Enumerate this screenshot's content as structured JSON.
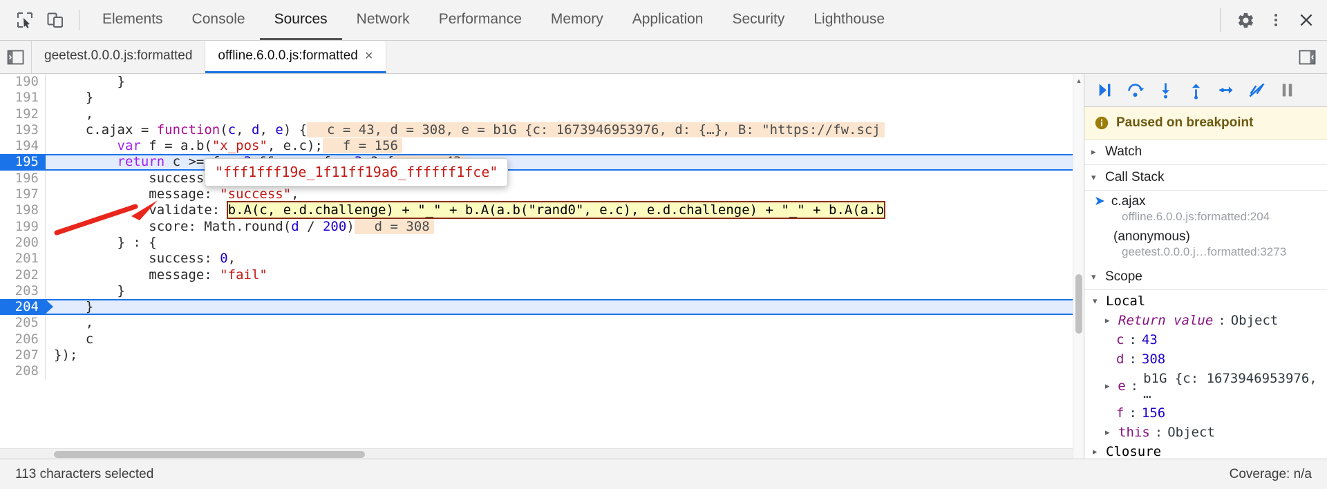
{
  "toolbar": {
    "inspect_icon": "inspect-element-icon",
    "device_icon": "device-toolbar-icon",
    "settings_icon": "gear-icon",
    "more_icon": "more-vertical-icon",
    "close_icon": "close-icon",
    "tabs": [
      {
        "label": "Elements",
        "selected": false
      },
      {
        "label": "Console",
        "selected": false
      },
      {
        "label": "Sources",
        "selected": true
      },
      {
        "label": "Network",
        "selected": false
      },
      {
        "label": "Performance",
        "selected": false
      },
      {
        "label": "Memory",
        "selected": false
      },
      {
        "label": "Application",
        "selected": false
      },
      {
        "label": "Security",
        "selected": false
      },
      {
        "label": "Lighthouse",
        "selected": false
      }
    ]
  },
  "sources": {
    "navigator_toggle_icon": "show-navigator-icon",
    "debugger_toggle_icon": "show-debugger-icon",
    "file_tabs": [
      {
        "label": "geetest.0.0.0.js:formatted",
        "active": false,
        "closeable": false
      },
      {
        "label": "offline.6.0.0.js:formatted",
        "active": true,
        "closeable": true,
        "close_label": "×"
      }
    ]
  },
  "editor": {
    "first_line_number": 190,
    "execution_line": 195,
    "breakpoint_line": 204,
    "lines": [
      {
        "n": 190,
        "tokens": [
          {
            "t": "        }",
            "c": "t-plain"
          }
        ]
      },
      {
        "n": 191,
        "tokens": [
          {
            "t": "    }",
            "c": "t-plain"
          }
        ]
      },
      {
        "n": 192,
        "tokens": [
          {
            "t": "    ,",
            "c": "t-plain"
          }
        ]
      },
      {
        "n": 193,
        "tokens": [
          {
            "t": "    c.ajax ",
            "c": "t-plain"
          },
          {
            "t": "= ",
            "c": "t-plain"
          },
          {
            "t": "function",
            "c": "t-fn"
          },
          {
            "t": "(",
            "c": "t-plain"
          },
          {
            "t": "c",
            "c": "t-var"
          },
          {
            "t": ", ",
            "c": "t-plain"
          },
          {
            "t": "d",
            "c": "t-var"
          },
          {
            "t": ", ",
            "c": "t-plain"
          },
          {
            "t": "e",
            "c": "t-var"
          },
          {
            "t": ") {",
            "c": "t-plain"
          }
        ],
        "inline_value": "c = 43, d = 308, e = b1G {c: 1673946953976, d: {…}, B: \"https://fw.scj"
      },
      {
        "n": 194,
        "tokens": [
          {
            "t": "        ",
            "c": "t-plain"
          },
          {
            "t": "var",
            "c": "t-kw"
          },
          {
            "t": " f ",
            "c": "t-plain"
          },
          {
            "t": "= a.",
            "c": "t-plain"
          },
          {
            "t": "b",
            "c": "t-plain"
          },
          {
            "t": "(",
            "c": "t-plain"
          },
          {
            "t": "\"x_pos\"",
            "c": "t-str"
          },
          {
            "t": ", e.c);",
            "c": "t-plain"
          }
        ],
        "inline_value": "f = 156"
      },
      {
        "n": 195,
        "tokens": [
          {
            "t": "        ",
            "c": "t-plain"
          },
          {
            "t": "return",
            "c": "t-kw"
          },
          {
            "t": " c >= f - ",
            "c": "t-plain"
          },
          {
            "t": "3",
            "c": "t-num"
          },
          {
            "t": " && c <= f + ",
            "c": "t-plain"
          },
          {
            "t": "3",
            "c": "t-num"
          },
          {
            "t": " ? {",
            "c": "t-plain"
          }
        ],
        "inline_value": "c = 43"
      },
      {
        "n": 196,
        "tokens": [
          {
            "t": "            success: ",
            "c": "t-plain"
          },
          {
            "t": "1",
            "c": "t-num"
          },
          {
            "t": ",",
            "c": "t-plain"
          }
        ]
      },
      {
        "n": 197,
        "tokens": [
          {
            "t": "            message: ",
            "c": "t-plain"
          },
          {
            "t": "\"success\"",
            "c": "t-str"
          },
          {
            "t": ",",
            "c": "t-plain"
          }
        ]
      },
      {
        "n": 198,
        "tokens": [
          {
            "t": "            validate: ",
            "c": "t-plain"
          }
        ],
        "selected_text": "b.A(c, e.d.challenge) + \"_\" + b.A(a.b(\"rand0\", e.c), e.d.challenge) + \"_\" + b.A(a.b"
      },
      {
        "n": 199,
        "tokens": [
          {
            "t": "            score: Math.",
            "c": "t-plain"
          },
          {
            "t": "round",
            "c": "t-plain"
          },
          {
            "t": "(",
            "c": "t-plain"
          },
          {
            "t": "d",
            "c": "t-var"
          },
          {
            "t": " / ",
            "c": "t-plain"
          },
          {
            "t": "200",
            "c": "t-num"
          },
          {
            "t": ")",
            "c": "t-plain"
          }
        ],
        "inline_value": "d = 308"
      },
      {
        "n": 200,
        "tokens": [
          {
            "t": "        } : {",
            "c": "t-plain"
          }
        ]
      },
      {
        "n": 201,
        "tokens": [
          {
            "t": "            success: ",
            "c": "t-plain"
          },
          {
            "t": "0",
            "c": "t-num"
          },
          {
            "t": ",",
            "c": "t-plain"
          }
        ]
      },
      {
        "n": 202,
        "tokens": [
          {
            "t": "            message: ",
            "c": "t-plain"
          },
          {
            "t": "\"fail\"",
            "c": "t-str"
          }
        ]
      },
      {
        "n": 203,
        "tokens": [
          {
            "t": "        }",
            "c": "t-plain"
          }
        ]
      },
      {
        "n": 204,
        "tokens": [
          {
            "t": "    }",
            "c": "t-plain"
          }
        ]
      },
      {
        "n": 205,
        "tokens": [
          {
            "t": "    ,",
            "c": "t-plain"
          }
        ]
      },
      {
        "n": 206,
        "tokens": [
          {
            "t": "    c",
            "c": "t-plain"
          }
        ]
      },
      {
        "n": 207,
        "tokens": [
          {
            "t": "});",
            "c": "t-plain"
          }
        ]
      },
      {
        "n": 208,
        "tokens": [
          {
            "t": "",
            "c": "t-plain"
          }
        ]
      }
    ],
    "tooltip": {
      "text": "\"fff1fff19e_1f11ff19a6_ffffff1fce\""
    }
  },
  "debugger": {
    "controls": [
      {
        "name": "resume-button",
        "glyph": "resume"
      },
      {
        "name": "step-over-button",
        "glyph": "step-over"
      },
      {
        "name": "step-into-button",
        "glyph": "step-into"
      },
      {
        "name": "step-out-button",
        "glyph": "step-out"
      },
      {
        "name": "step-button",
        "glyph": "step"
      },
      {
        "name": "deactivate-breakpoints-button",
        "glyph": "deactivate"
      },
      {
        "name": "pause-on-exceptions-button",
        "glyph": "pause"
      }
    ],
    "paused_banner": {
      "icon": "info-icon",
      "text": "Paused on breakpoint"
    },
    "watch": {
      "label": "Watch",
      "expanded": false,
      "caret": "▸"
    },
    "call_stack": {
      "label": "Call Stack",
      "expanded": true,
      "caret": "▾",
      "frames": [
        {
          "name": "c.ajax",
          "location": "offline.6.0.0.js:formatted:204",
          "active": true
        },
        {
          "name": "(anonymous)",
          "location": "geetest.0.0.0.j…formatted:3273",
          "active": false
        }
      ]
    },
    "scope": {
      "label": "Scope",
      "expanded": true,
      "caret": "▾",
      "groups": [
        {
          "label": "Local",
          "caret": "▾",
          "entries": [
            {
              "caret": "▸",
              "name": "Return value",
              "sep": ": ",
              "value": "Object",
              "italic": true,
              "value_class": "k-obj"
            },
            {
              "caret": "",
              "name": "c",
              "sep": ": ",
              "value": "43",
              "value_class": "k-num"
            },
            {
              "caret": "",
              "name": "d",
              "sep": ": ",
              "value": "308",
              "value_class": "k-num"
            },
            {
              "caret": "▸",
              "name": "e",
              "sep": ": ",
              "value": "b1G {c: 1673946953976, …",
              "value_class": "k-class"
            },
            {
              "caret": "",
              "name": "f",
              "sep": ": ",
              "value": "156",
              "value_class": "k-num"
            },
            {
              "caret": "▸",
              "name": "this",
              "sep": ": ",
              "value": "Object",
              "value_class": "k-obj"
            }
          ]
        },
        {
          "label": "Closure",
          "caret": "▸",
          "entries": []
        }
      ]
    }
  },
  "status_bar": {
    "selection_text": "113 characters selected",
    "coverage_text": "Coverage: n/a"
  }
}
